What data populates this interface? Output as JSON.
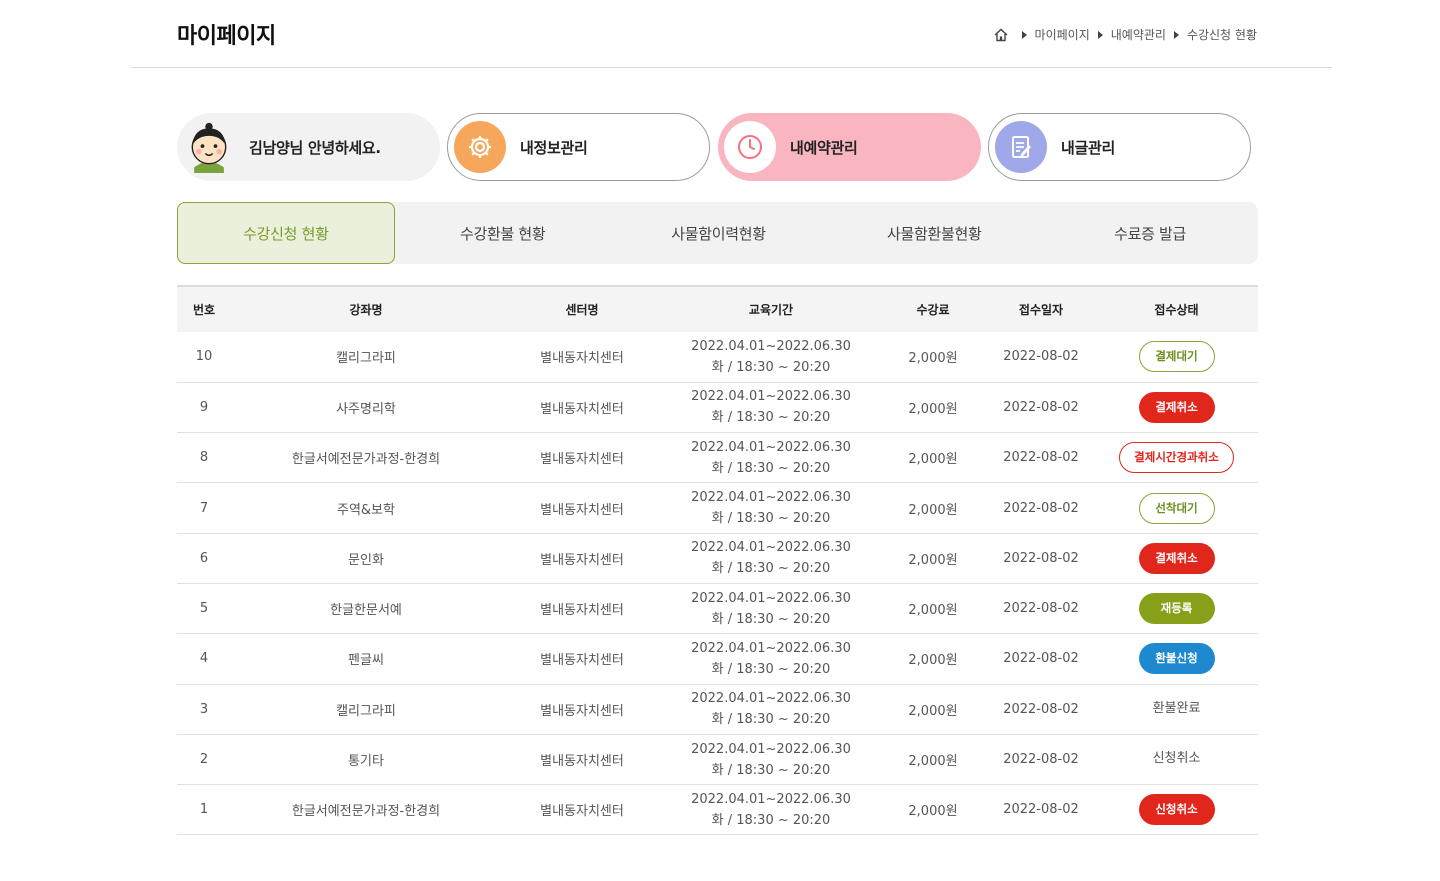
{
  "header": {
    "title": "마이페이지",
    "breadcrumb": [
      "마이페이지",
      "내예약관리",
      "수강신청 현황"
    ]
  },
  "menu": {
    "greeting": "김남양님 안녕하세요.",
    "cards": [
      {
        "label": "내정보관리",
        "icon": "gear-icon",
        "color": "#f7a75c"
      },
      {
        "label": "내예약관리",
        "icon": "clock-icon",
        "color": "#f7707f"
      },
      {
        "label": "내글관리",
        "icon": "document-edit-icon",
        "color": "#9fa8e8"
      }
    ]
  },
  "tabs": [
    "수강신청 현황",
    "수강환불 현황",
    "사물함이력현황",
    "사물함환불현황",
    "수료증 발급"
  ],
  "table": {
    "headers": [
      "번호",
      "강좌명",
      "센터명",
      "교육기간",
      "수강료",
      "접수일자",
      "접수상태"
    ],
    "rows": [
      {
        "no": "10",
        "course": "캘리그라피",
        "center": "별내동자치센터",
        "period1": "2022.04.01~2022.06.30",
        "period2": "화 / 18:30 ~ 20:20",
        "fee": "2,000원",
        "date": "2022-08-02",
        "status": "결제대기",
        "style": "outline-green"
      },
      {
        "no": "9",
        "course": "사주명리학",
        "center": "별내동자치센터",
        "period1": "2022.04.01~2022.06.30",
        "period2": "화 / 18:30 ~ 20:20",
        "fee": "2,000원",
        "date": "2022-08-02",
        "status": "결제취소",
        "style": "fill-red"
      },
      {
        "no": "8",
        "course": "한글서예전문가과정-한경희",
        "center": "별내동자치센터",
        "period1": "2022.04.01~2022.06.30",
        "period2": "화 / 18:30 ~ 20:20",
        "fee": "2,000원",
        "date": "2022-08-02",
        "status": "결제시간경과취소",
        "style": "outline-red"
      },
      {
        "no": "7",
        "course": "주역&보학",
        "center": "별내동자치센터",
        "period1": "2022.04.01~2022.06.30",
        "period2": "화 / 18:30 ~ 20:20",
        "fee": "2,000원",
        "date": "2022-08-02",
        "status": "선착대기",
        "style": "outline-green"
      },
      {
        "no": "6",
        "course": "문인화",
        "center": "별내동자치센터",
        "period1": "2022.04.01~2022.06.30",
        "period2": "화 / 18:30 ~ 20:20",
        "fee": "2,000원",
        "date": "2022-08-02",
        "status": "결제취소",
        "style": "fill-red"
      },
      {
        "no": "5",
        "course": "한글한문서예",
        "center": "별내동자치센터",
        "period1": "2022.04.01~2022.06.30",
        "period2": "화 / 18:30 ~ 20:20",
        "fee": "2,000원",
        "date": "2022-08-02",
        "status": "재등록",
        "style": "fill-olive"
      },
      {
        "no": "4",
        "course": "펜글씨",
        "center": "별내동자치센터",
        "period1": "2022.04.01~2022.06.30",
        "period2": "화 / 18:30 ~ 20:20",
        "fee": "2,000원",
        "date": "2022-08-02",
        "status": "환불신청",
        "style": "fill-blue"
      },
      {
        "no": "3",
        "course": "캘리그라피",
        "center": "별내동자치센터",
        "period1": "2022.04.01~2022.06.30",
        "period2": "화 / 18:30 ~ 20:20",
        "fee": "2,000원",
        "date": "2022-08-02",
        "status": "환불완료",
        "style": "plain"
      },
      {
        "no": "2",
        "course": "통기타",
        "center": "별내동자치센터",
        "period1": "2022.04.01~2022.06.30",
        "period2": "화 / 18:30 ~ 20:20",
        "fee": "2,000원",
        "date": "2022-08-02",
        "status": "신청취소",
        "style": "plain"
      },
      {
        "no": "1",
        "course": "한글서예전문가과정-한경희",
        "center": "별내동자치센터",
        "period1": "2022.04.01~2022.06.30",
        "period2": "화 / 18:30 ~ 20:20",
        "fee": "2,000원",
        "date": "2022-08-02",
        "status": "신청취소",
        "style": "fill-red"
      }
    ]
  }
}
